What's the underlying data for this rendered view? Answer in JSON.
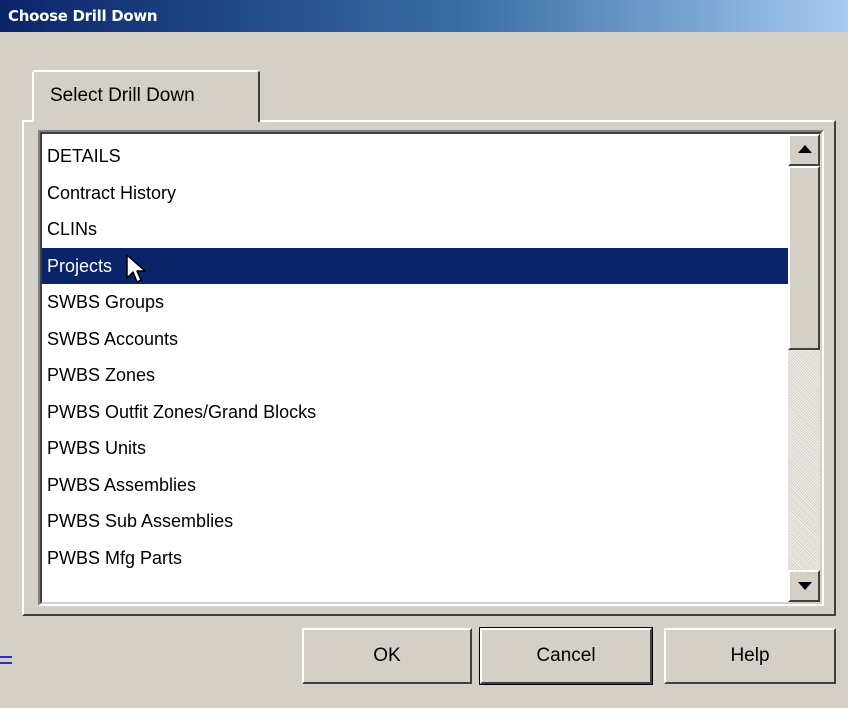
{
  "window": {
    "title": "Choose Drill Down"
  },
  "tabs": [
    {
      "label": "Select Drill Down"
    }
  ],
  "list": {
    "items": [
      {
        "label": "DETAILS",
        "selected": false
      },
      {
        "label": "Contract History",
        "selected": false
      },
      {
        "label": "CLINs",
        "selected": false
      },
      {
        "label": "Projects",
        "selected": true
      },
      {
        "label": "SWBS Groups",
        "selected": false
      },
      {
        "label": "SWBS Accounts",
        "selected": false
      },
      {
        "label": "PWBS Zones",
        "selected": false
      },
      {
        "label": "PWBS Outfit Zones/Grand Blocks",
        "selected": false
      },
      {
        "label": "PWBS Units",
        "selected": false
      },
      {
        "label": "PWBS Assemblies",
        "selected": false
      },
      {
        "label": "PWBS Sub Assemblies",
        "selected": false
      },
      {
        "label": "PWBS Mfg Parts",
        "selected": false
      }
    ],
    "selection_color": "#0a246a"
  },
  "buttons": {
    "ok_label": "OK",
    "cancel_label": "Cancel",
    "help_label": "Help"
  },
  "colors": {
    "title_gradient_start": "#0a246a",
    "title_gradient_end": "#a6caf0",
    "face": "#d4d0c8"
  }
}
